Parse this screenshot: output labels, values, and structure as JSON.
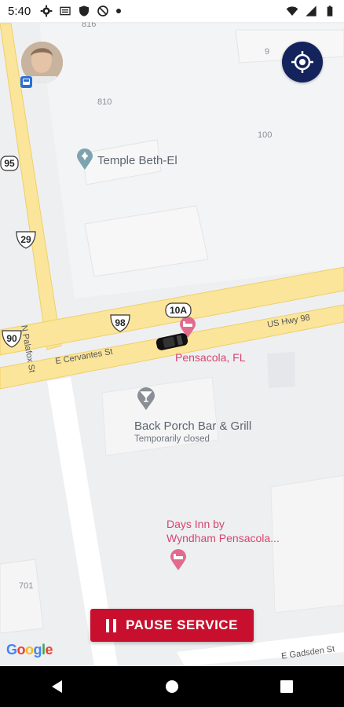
{
  "status_bar": {
    "time": "5:40",
    "left_icons": [
      "gear-icon",
      "sd-card-icon",
      "shield-icon",
      "blocked-circle-icon",
      "dot-icon"
    ],
    "right_icons": [
      "wifi-icon",
      "signal-icon",
      "battery-icon"
    ]
  },
  "map": {
    "block_numbers": [
      "816",
      "9",
      "810",
      "100",
      "701"
    ],
    "poi": {
      "temple": "Temple Beth-El",
      "bar_name": "Back Porch Bar & Grill",
      "bar_status": "Temporarily closed",
      "pensacola": "Pensacola, FL",
      "days_inn_line1": "Days Inn by",
      "days_inn_line2": "Wyndham Pensacola..."
    },
    "streets": {
      "palafox": "N Palafox St",
      "cervantes": "E Cervantes St",
      "us_hwy_98": "US Hwy 98",
      "gadsden": "E Gadsden St"
    },
    "shields": {
      "s95": "95",
      "s29": "29",
      "s90": "90",
      "s98": "98",
      "s10a": "10A"
    },
    "attribution": "Google"
  },
  "controls": {
    "pause_label": "PAUSE SERVICE"
  },
  "colors": {
    "map_bg": "#eeeff1",
    "road_yellow": "#fbe59a",
    "accent_navy": "#14235c",
    "pause_red": "#c8102e",
    "poi_pink": "#d6456e"
  }
}
